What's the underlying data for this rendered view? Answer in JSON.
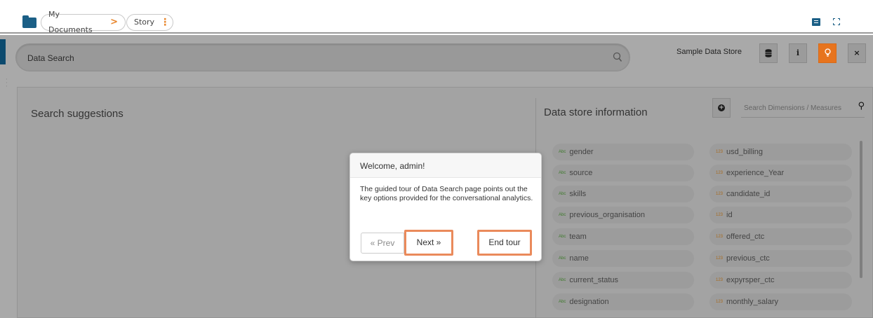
{
  "breadcrumb": {
    "items": [
      {
        "label": "My Documents",
        "separator": ">"
      },
      {
        "label": "Story"
      }
    ]
  },
  "top_icons": [
    "chat-icon",
    "fullscreen-icon"
  ],
  "search": {
    "placeholder": "Data Search"
  },
  "data_store": {
    "label": "Sample Data Store",
    "buttons": [
      {
        "icon": "database-icon"
      },
      {
        "icon": "info-icon",
        "glyph": "i"
      },
      {
        "icon": "lightbulb-icon",
        "color": "#e7741e"
      },
      {
        "icon": "close-icon",
        "glyph": "×"
      }
    ]
  },
  "suggestions": {
    "title": "Search suggestions"
  },
  "data_store_info": {
    "title": "Data store information",
    "search_placeholder": "Search Dimensions / Measures",
    "dimension_tag": "Abc",
    "measure_tag": "123",
    "dimensions": [
      "gender",
      "source",
      "skills",
      "previous_organisation",
      "team",
      "name",
      "current_status",
      "designation"
    ],
    "measures": [
      "usd_billing",
      "experience_Year",
      "candidate_id",
      "id",
      "offered_ctc",
      "previous_ctc",
      "expyrsper_ctc",
      "monthly_salary"
    ]
  },
  "tour": {
    "title": "Welcome, admin!",
    "body": "The guided tour of Data Search page points out the key options provided for the conversational analytics.",
    "prev_label": "« Prev",
    "next_label": "Next »",
    "end_label": "End tour"
  },
  "colors": {
    "accent": "#e7741e",
    "brand": "#1b5f86",
    "highlight_border": "#ea8a5b"
  }
}
